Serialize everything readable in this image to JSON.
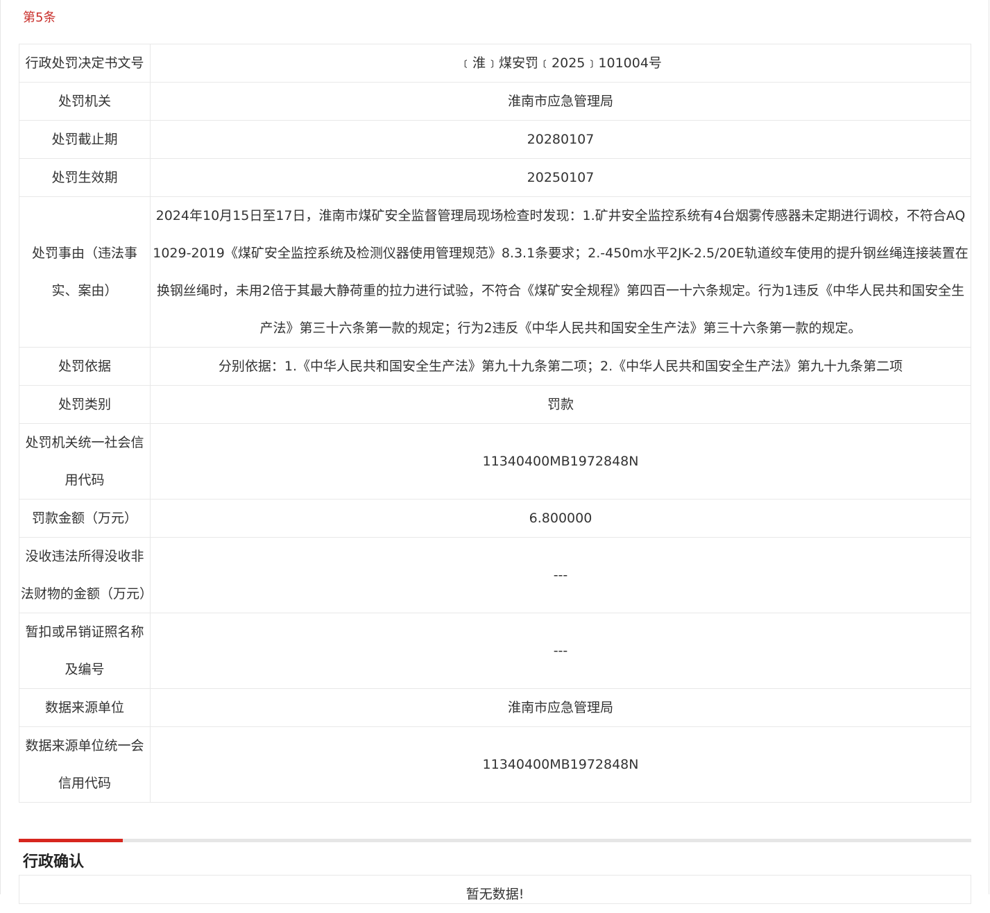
{
  "record": {
    "index_label": "第5条",
    "rows": [
      {
        "label": "行政处罚决定书文号",
        "value": "﹝淮﹞煤安罚﹝2025﹞101004号"
      },
      {
        "label": "处罚机关",
        "value": "淮南市应急管理局"
      },
      {
        "label": "处罚截止期",
        "value": "20280107"
      },
      {
        "label": "处罚生效期",
        "value": "20250107"
      },
      {
        "label": "处罚事由（违法事实、案由）",
        "value": "2024年10月15日至17日，淮南市煤矿安全监督管理局现场检查时发现：1.矿井安全监控系统有4台烟雾传感器未定期进行调校，不符合AQ1029-2019《煤矿安全监控系统及检测仪器使用管理规范》8.3.1条要求；2.-450m水平2JK-2.5/20E轨道绞车使用的提升钢丝绳连接装置在换钢丝绳时，未用2倍于其最大静荷重的拉力进行试验，不符合《煤矿安全规程》第四百一十六条规定。行为1违反《中华人民共和国安全生产法》第三十六条第一款的规定；行为2违反《中华人民共和国安全生产法》第三十六条第一款的规定。"
      },
      {
        "label": "处罚依据",
        "value": "分别依据：1.《中华人民共和国安全生产法》第九十九条第二项；2.《中华人民共和国安全生产法》第九十九条第二项"
      },
      {
        "label": "处罚类别",
        "value": "罚款"
      },
      {
        "label": "处罚机关统一社会信用代码",
        "value": "11340400MB1972848N"
      },
      {
        "label": "罚款金额（万元）",
        "value": "6.800000"
      },
      {
        "label": "没收违法所得没收非法财物的金额（万元）",
        "value": "---"
      },
      {
        "label": "暂扣或吊销证照名称及编号",
        "value": "---"
      },
      {
        "label": "数据来源单位",
        "value": "淮南市应急管理局"
      },
      {
        "label": "数据来源单位统一会信用代码",
        "value": "11340400MB1972848N"
      }
    ]
  },
  "section": {
    "title": "行政确认",
    "empty_text": "暂无数据!"
  },
  "colors": {
    "accent": "#d7261e",
    "index_text": "#c9302c",
    "border": "#e8e8e8"
  }
}
